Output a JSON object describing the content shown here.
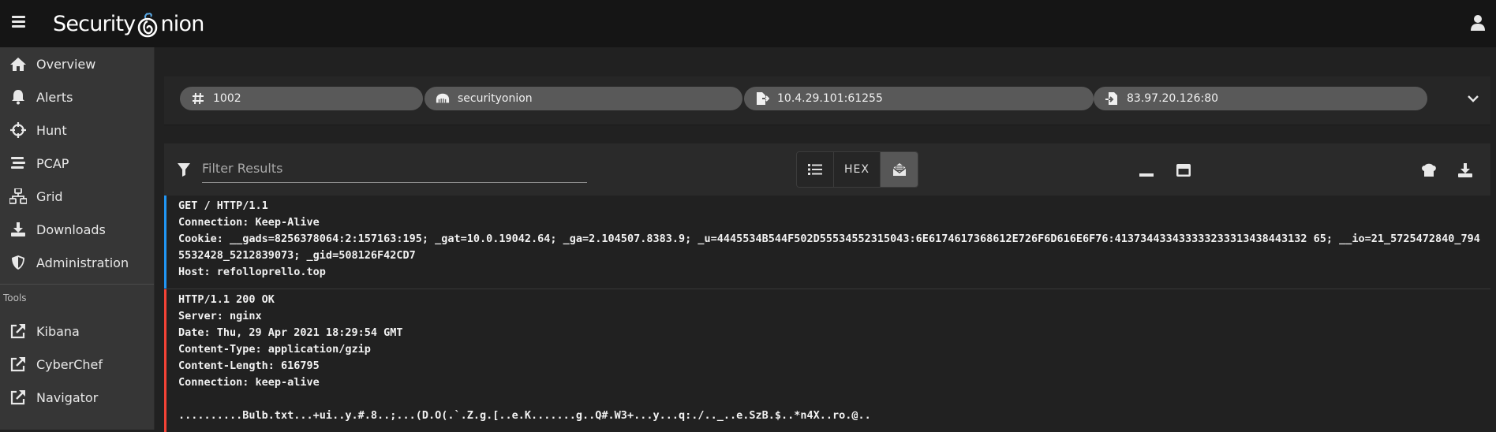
{
  "app": {
    "logo_text_1": "Security",
    "logo_text_2": "nion"
  },
  "sidebar": {
    "items": [
      {
        "label": "Overview",
        "icon": "home-icon"
      },
      {
        "label": "Alerts",
        "icon": "bell-icon"
      },
      {
        "label": "Hunt",
        "icon": "crosshairs-icon"
      },
      {
        "label": "PCAP",
        "icon": "stream-icon"
      },
      {
        "label": "Grid",
        "icon": "network-icon"
      },
      {
        "label": "Downloads",
        "icon": "download-icon"
      },
      {
        "label": "Administration",
        "icon": "shield-icon"
      }
    ],
    "tools_label": "Tools",
    "tools": [
      {
        "label": "Kibana",
        "icon": "external-link-icon"
      },
      {
        "label": "CyberChef",
        "icon": "external-link-icon"
      },
      {
        "label": "Navigator",
        "icon": "external-link-icon"
      }
    ]
  },
  "header": {
    "chips": [
      {
        "label": "1002",
        "icon": "hash-icon"
      },
      {
        "label": "securityonion",
        "icon": "sensor-icon"
      },
      {
        "label": "10.4.29.101:61255",
        "icon": "source-file-icon"
      },
      {
        "label": "83.97.20.126:80",
        "icon": "destination-file-icon"
      }
    ]
  },
  "toolbar": {
    "filter_placeholder": "Filter Results",
    "hex_label": "HEX"
  },
  "content": {
    "request": {
      "color": "#2196f3",
      "lines": [
        "GET / HTTP/1.1",
        "Connection: Keep-Alive",
        "Cookie: __gads=8256378064:2:157163:195; _gat=10.0.19042.64; _ga=2.104507.8383.9; _u=4445534B544F502D55534552315043:6E6174617368612E726F6D616E6F76:413734433433333233313438443132 65; __io=21_5725472840_7945532428_5212839073; _gid=508126F42CD7",
        "Host: refolloprello.top"
      ]
    },
    "response": {
      "color": "#f44336",
      "lines": [
        "HTTP/1.1 200 OK",
        "Server: nginx",
        "Date: Thu, 29 Apr 2021 18:29:54 GMT",
        "Content-Type: application/gzip",
        "Content-Length: 616795",
        "Connection: keep-alive",
        "",
        "..........Bulb.txt...+ui..y.#.8..;...(D.O(.`.Z.g.[..e.K.......g..Q#.W3+...y...q:./.._..e.SzB.$..*n4X..ro.@.."
      ]
    }
  }
}
